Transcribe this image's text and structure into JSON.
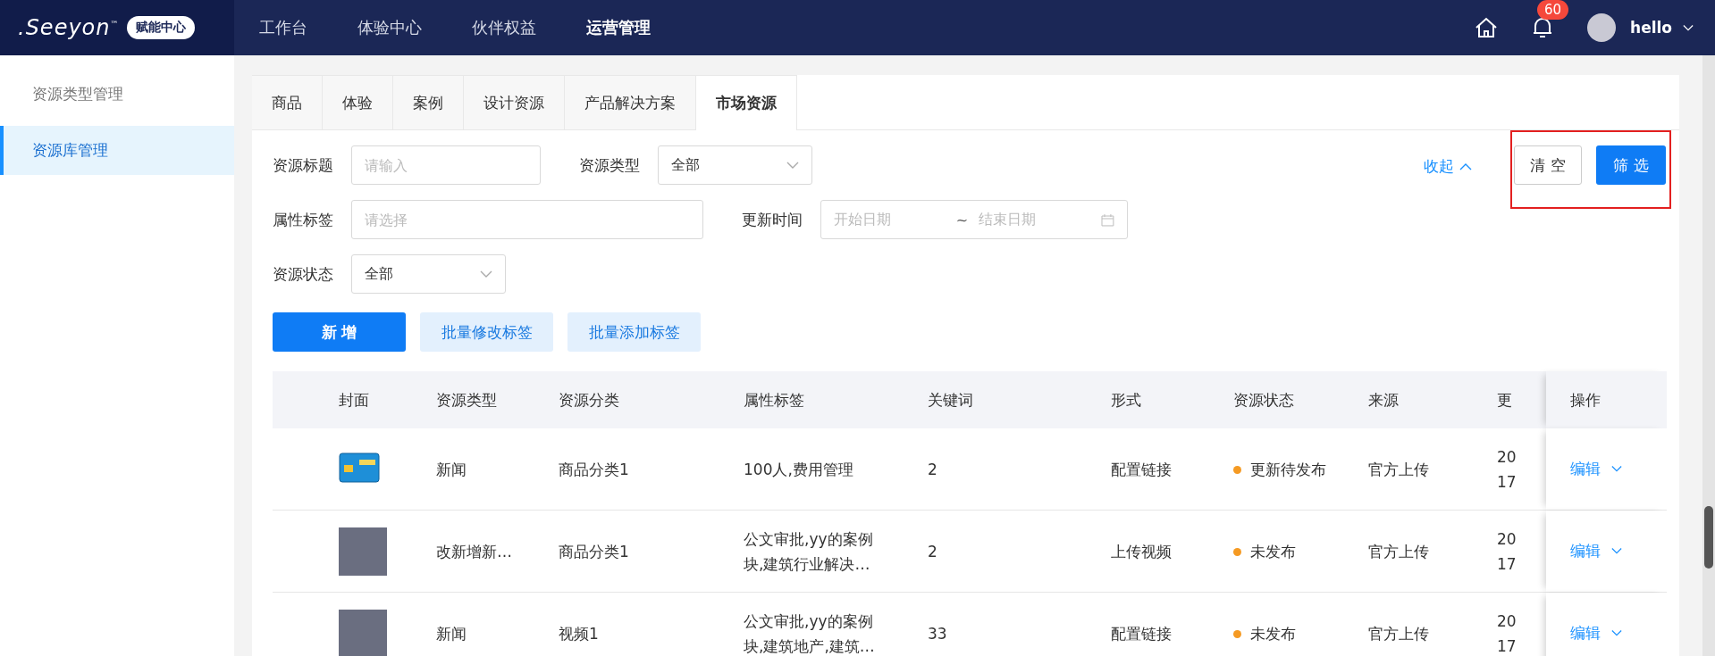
{
  "header": {
    "logo": ".Seeyon",
    "logo_mark": "™",
    "badge": "赋能中心",
    "nav": [
      {
        "label": "工作台",
        "selected": false
      },
      {
        "label": "体验中心",
        "selected": false
      },
      {
        "label": "伙伴权益",
        "selected": false
      },
      {
        "label": "运营管理",
        "selected": true
      }
    ],
    "notification_count": "60",
    "user": "hello"
  },
  "sidebar": {
    "items": [
      {
        "label": "资源类型管理",
        "selected": false
      },
      {
        "label": "资源库管理",
        "selected": true
      }
    ]
  },
  "tabs": [
    {
      "label": "商品",
      "selected": false
    },
    {
      "label": "体验",
      "selected": false
    },
    {
      "label": "案例",
      "selected": false
    },
    {
      "label": "设计资源",
      "selected": false
    },
    {
      "label": "产品解决方案",
      "selected": false
    },
    {
      "label": "市场资源",
      "selected": true
    }
  ],
  "filters": {
    "title": {
      "label": "资源标题",
      "placeholder": "请输入"
    },
    "type": {
      "label": "资源类型",
      "value": "全部"
    },
    "tags": {
      "label": "属性标签",
      "placeholder": "请选择"
    },
    "updated": {
      "label": "更新时间",
      "start_placeholder": "开始日期",
      "separator": "~",
      "end_placeholder": "结束日期"
    },
    "status": {
      "label": "资源状态",
      "value": "全部"
    },
    "collapse": "收起",
    "clear": "清 空",
    "apply": "筛 选"
  },
  "actions": [
    {
      "label": "新 增",
      "kind": "primary"
    },
    {
      "label": "批量修改标签",
      "kind": "light"
    },
    {
      "label": "批量添加标签",
      "kind": "light"
    }
  ],
  "table": {
    "columns": [
      "封面",
      "资源类型",
      "资源分类",
      "属性标签",
      "关键词",
      "形式",
      "资源状态",
      "来源",
      "更",
      "操作"
    ],
    "rows": [
      {
        "cover": {
          "kind": "icon"
        },
        "type": "新闻",
        "category": "商品分类1",
        "tags": [
          "100人,费用管理"
        ],
        "keyword": "2",
        "form": "配置链接",
        "status": "更新待发布",
        "color": "#f59a23",
        "source": "官方上传",
        "updated": [
          "20",
          "17"
        ],
        "action": "编辑"
      },
      {
        "cover": {
          "kind": "photo"
        },
        "type": "改新增新…",
        "category": "商品分类1",
        "tags": [
          "公文审批,yy的案例",
          "块,建筑行业解决…"
        ],
        "keyword": "2",
        "form": "上传视频",
        "status": "未发布",
        "color": "#f59a23",
        "source": "官方上传",
        "updated": [
          "20",
          "17"
        ],
        "action": "编辑"
      },
      {
        "cover": {
          "kind": "photo"
        },
        "type": "新闻",
        "category": "视频1",
        "tags": [
          "公文审批,yy的案例",
          "块,建筑地产,建筑…"
        ],
        "keyword": "33",
        "form": "配置链接",
        "status": "未发布",
        "color": "#f59a23",
        "source": "官方上传",
        "updated": [
          "20",
          "17"
        ],
        "action": "编辑"
      }
    ]
  }
}
